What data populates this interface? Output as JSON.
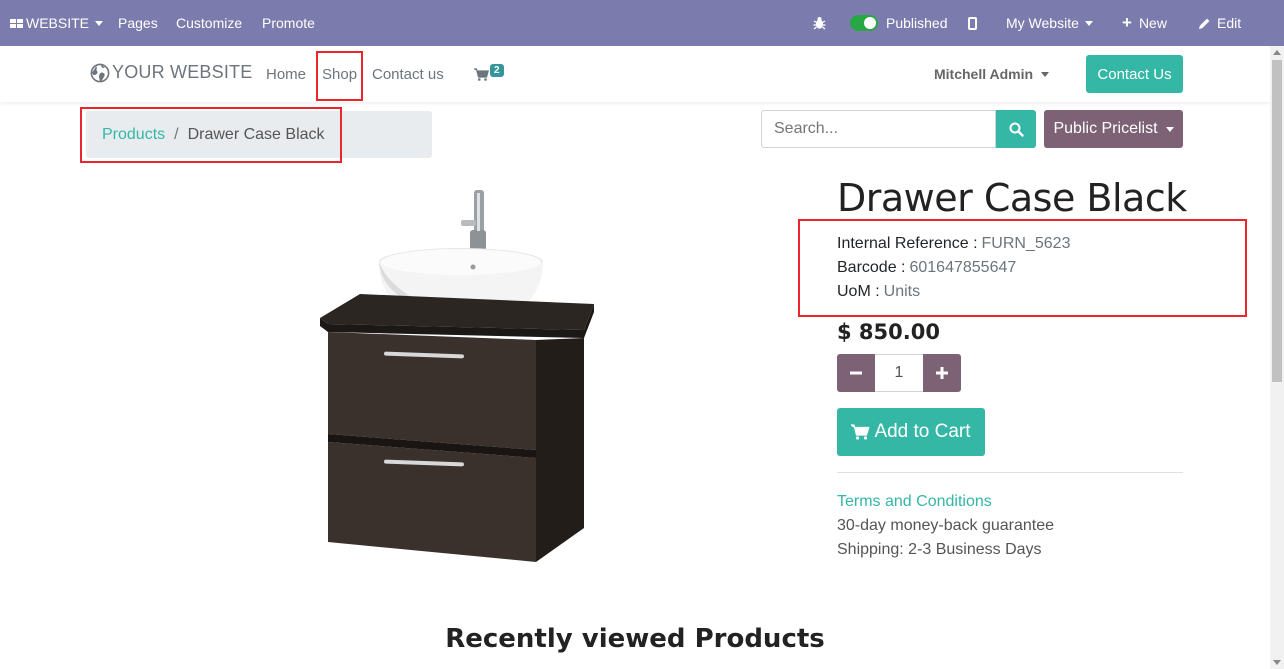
{
  "admin_bar": {
    "website_menu": "WEBSITE",
    "pages": "Pages",
    "customize": "Customize",
    "promote": "Promote",
    "published": "Published",
    "my_website": "My Website",
    "new": "New",
    "edit": "Edit"
  },
  "header": {
    "logo": "YOUR WEBSITE",
    "nav": [
      "Home",
      "Shop",
      "Contact us"
    ],
    "cart_count": "2",
    "user": "Mitchell Admin",
    "contact_button": "Contact Us"
  },
  "breadcrumb": {
    "parent": "Products",
    "separator": "/",
    "current": "Drawer Case Black"
  },
  "search": {
    "placeholder": "Search..."
  },
  "pricelist": "Public Pricelist",
  "product": {
    "name": "Drawer Case Black",
    "attributes": [
      {
        "label": "Internal Reference :",
        "value": "FURN_5623"
      },
      {
        "label": "Barcode :",
        "value": "601647855647"
      },
      {
        "label": "UoM :",
        "value": "Units"
      }
    ],
    "price": "$ 850.00",
    "quantity": "1",
    "add_to_cart": "Add to Cart",
    "terms_link": "Terms and Conditions",
    "guarantee": "30-day money-back guarantee",
    "shipping": "Shipping: 2-3 Business Days"
  },
  "recently_viewed_title": "Recently viewed Products",
  "colors": {
    "admin_bar": "#7c7bad",
    "primary": "#35b7a6",
    "secondary": "#7c6274",
    "highlight": "#e8262b"
  }
}
